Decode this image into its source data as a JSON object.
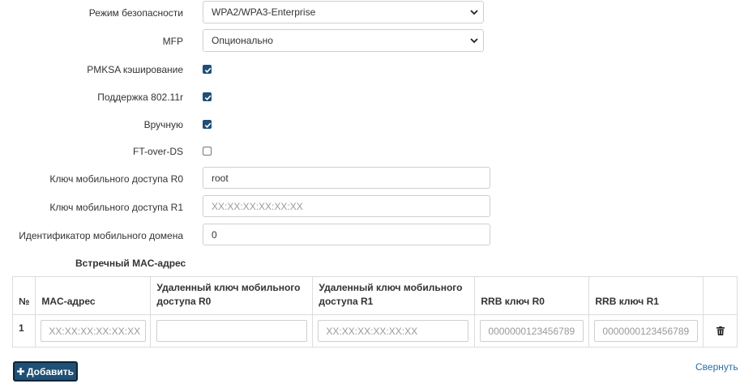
{
  "form": {
    "security_mode": {
      "label": "Режим безопасности",
      "value": "WPA2/WPA3-Enterprise"
    },
    "mfp": {
      "label": "MFP",
      "value": "Опционально"
    },
    "pmksa": {
      "label": "PMKSA кэширование",
      "checked": true
    },
    "support_80211r": {
      "label": "Поддержка 802.11r",
      "checked": true
    },
    "manual": {
      "label": "Вручную",
      "checked": true
    },
    "ft_over_ds": {
      "label": "FT-over-DS",
      "checked": false
    },
    "r0_key": {
      "label": "Ключ мобильного доступа R0",
      "value": "root"
    },
    "r1_key": {
      "label": "Ключ мобильного доступа R1",
      "placeholder": "XX:XX:XX:XX:XX:XX"
    },
    "mobility_domain": {
      "label": "Идентификатор мобильного домена",
      "value": "0"
    }
  },
  "peers": {
    "title": "Встречный MAC-адрес",
    "headers": {
      "num": "№",
      "mac": "MAC-адрес",
      "r0_line1": "Удаленный ключ мобильного",
      "r0_line2": "доступа R0",
      "r1_line1": "Удаленный ключ мобильного",
      "r1_line2": "доступа R1",
      "rrb_r0": "RRB ключ R0",
      "rrb_r1": "RRB ключ R1"
    },
    "rows": [
      {
        "num": "1",
        "mac_placeholder": "XX:XX:XX:XX:XX:XX",
        "remote_r0_value": "",
        "remote_r1_placeholder": "XX:XX:XX:XX:XX:XX",
        "rrb_r0_placeholder": "0000000123456789",
        "rrb_r1_placeholder": "0000000123456789",
        "delete_icon": "trash-icon"
      }
    ]
  },
  "actions": {
    "add_label": "Добавить",
    "add_icon": "plus-icon",
    "collapse_label": "Свернуть"
  },
  "colors": {
    "checkbox": "#1d4f78",
    "button": "#1f5075",
    "link": "#2a6fa8"
  }
}
